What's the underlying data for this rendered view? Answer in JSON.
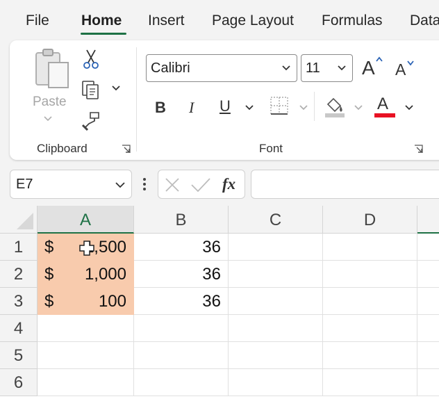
{
  "tabs": [
    "File",
    "Home",
    "Insert",
    "Page Layout",
    "Formulas",
    "Data"
  ],
  "active_tab": "Home",
  "ribbon": {
    "clipboard": {
      "paste_label": "Paste",
      "group_label": "Clipboard"
    },
    "font": {
      "font_name": "Calibri",
      "font_size": "11",
      "bold": "B",
      "italic": "I",
      "underline": "U",
      "font_color_glyph": "A",
      "group_label": "Font",
      "font_color": "#e81123",
      "fill_color": "#c8c8c8"
    }
  },
  "formula_bar": {
    "name_box": "E7",
    "fx_label": "fx",
    "formula": ""
  },
  "grid": {
    "columns": [
      "A",
      "B",
      "C",
      "D"
    ],
    "rows": [
      "1",
      "2",
      "3",
      "4",
      "5",
      "6"
    ],
    "cells": [
      {
        "currency": "$",
        "a_value": "1,500",
        "b_value": "36"
      },
      {
        "currency": "$",
        "a_value": "1,000",
        "b_value": "36"
      },
      {
        "currency": "$",
        "a_value": "100",
        "b_value": "36"
      }
    ],
    "highlight_color": "#f8cbad",
    "accent_color": "#1e7145"
  }
}
